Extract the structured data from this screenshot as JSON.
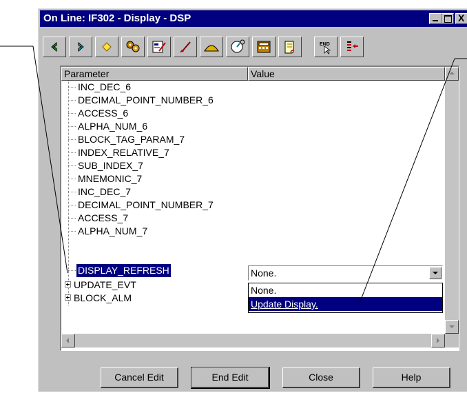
{
  "window": {
    "title": "On Line: IF302 - Display - DSP",
    "controls": {
      "minimize": "_",
      "maximize": "□",
      "close": "X"
    }
  },
  "toolbar": {
    "tools": [
      {
        "name": "back-arrow-icon",
        "color": "#00a000"
      },
      {
        "name": "forward-arrow-icon",
        "color": "#00b0b0"
      },
      {
        "name": "diamond-icon",
        "color": "#e0c000"
      },
      {
        "name": "gear-cluster-icon",
        "color": "#c08000"
      },
      {
        "name": "edit-form-icon",
        "color": "#800080"
      },
      {
        "name": "brush-icon",
        "color": "#c00000"
      },
      {
        "name": "hill-chart-icon",
        "color": "#e0b000"
      },
      {
        "name": "gauge-icon",
        "color": "#008080"
      },
      {
        "name": "calculator-icon",
        "color": "#c08000"
      },
      {
        "name": "scroll-icon",
        "color": "#806000"
      },
      {
        "name": "end-cursor-icon",
        "color": "#000000"
      },
      {
        "name": "list-arrow-icon",
        "color": "#c00000"
      }
    ],
    "end_label": "END"
  },
  "grid": {
    "headers": {
      "parameter": "Parameter",
      "value": "Value"
    },
    "rows": [
      {
        "label": "INC_DEC_6",
        "value": ""
      },
      {
        "label": "DECIMAL_POINT_NUMBER_6",
        "value": ""
      },
      {
        "label": "ACCESS_6",
        "value": ""
      },
      {
        "label": "ALPHA_NUM_6",
        "value": ""
      },
      {
        "label": "BLOCK_TAG_PARAM_7",
        "value": ""
      },
      {
        "label": "INDEX_RELATIVE_7",
        "value": ""
      },
      {
        "label": "SUB_INDEX_7",
        "value": ""
      },
      {
        "label": "MNEMONIC_7",
        "value": ""
      },
      {
        "label": "INC_DEC_7",
        "value": ""
      },
      {
        "label": "DECIMAL_POINT_NUMBER_7",
        "value": ""
      },
      {
        "label": "ACCESS_7",
        "value": ""
      },
      {
        "label": "ALPHA_NUM_7",
        "value": ""
      },
      {
        "label": "DISPLAY_REFRESH",
        "value": "None.",
        "selected": true
      },
      {
        "label": "UPDATE_EVT",
        "value": "",
        "expandable": true
      },
      {
        "label": "BLOCK_ALM",
        "value": "",
        "expandable": true
      }
    ],
    "dropdown": {
      "selected": "None.",
      "options": [
        "None.",
        "Update Display."
      ],
      "highlighted": "Update Display."
    }
  },
  "buttons": {
    "cancel_edit": "Cancel Edit",
    "end_edit": "End Edit",
    "close": "Close",
    "help": "Help"
  },
  "colors": {
    "title_bar": "#000080",
    "selection": "#000080",
    "face": "#c0c0c0"
  }
}
